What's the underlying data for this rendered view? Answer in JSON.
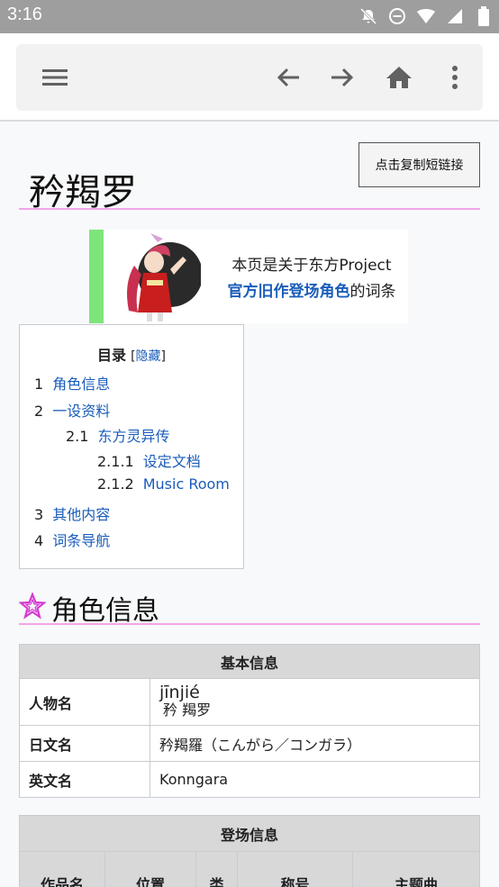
{
  "status_bar": {
    "time": "3:16"
  },
  "toolbar": {
    "menu_icon": "hamburger-menu-icon",
    "back_icon": "arrow-left-icon",
    "forward_icon": "arrow-right-icon",
    "home_icon": "home-icon",
    "more_icon": "more-vert-icon"
  },
  "page": {
    "copy_link_label": "点击复制短链接",
    "title": "矜羯罗",
    "notice_line1": "本页是关于东方Project",
    "notice_link": "官方旧作登场角色",
    "notice_suffix": "的词条"
  },
  "toc": {
    "title": "目录",
    "hide_prefix": "[",
    "hide_label": "隐藏",
    "hide_suffix": "]",
    "items": [
      {
        "num": "1",
        "label": "角色信息"
      },
      {
        "num": "2",
        "label": "一设资料"
      },
      {
        "num": "2.1",
        "label": "东方灵异传"
      },
      {
        "num": "2.1.1",
        "label": "设定文档"
      },
      {
        "num": "2.1.2",
        "label": "Music Room"
      },
      {
        "num": "3",
        "label": "其他内容"
      },
      {
        "num": "4",
        "label": "词条导航"
      }
    ]
  },
  "section1": {
    "title": "角色信息"
  },
  "basic_info": {
    "header": "基本信息",
    "rows": [
      {
        "key": "人物名",
        "pinyin": "jīnjié",
        "value": "矜 羯罗"
      },
      {
        "key": "日文名",
        "value": "矜羯羅（こんがら／コンガラ）"
      },
      {
        "key": "英文名",
        "value": "Konngara"
      }
    ]
  },
  "appearance_info": {
    "header": "登场信息",
    "columns": [
      "作品名",
      "位置",
      "类",
      "称号",
      "主题曲"
    ]
  }
}
